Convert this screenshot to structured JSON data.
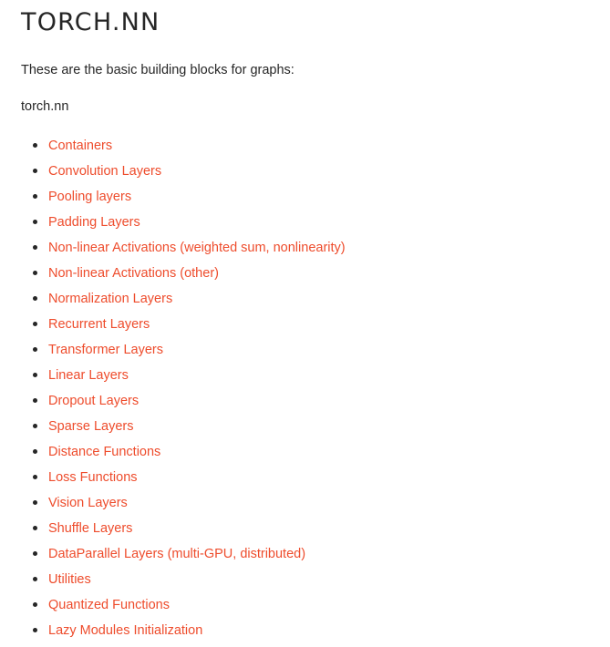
{
  "page": {
    "title": "TORCH.NN",
    "intro": "These are the basic building blocks for graphs:",
    "module_name": "torch.nn"
  },
  "colors": {
    "link": "#ee4c2c",
    "text": "#262626",
    "background": "#ffffff"
  },
  "toc": [
    {
      "label": "Containers"
    },
    {
      "label": "Convolution Layers"
    },
    {
      "label": "Pooling layers"
    },
    {
      "label": "Padding Layers"
    },
    {
      "label": "Non-linear Activations (weighted sum, nonlinearity)"
    },
    {
      "label": "Non-linear Activations (other)"
    },
    {
      "label": "Normalization Layers"
    },
    {
      "label": "Recurrent Layers"
    },
    {
      "label": "Transformer Layers"
    },
    {
      "label": "Linear Layers"
    },
    {
      "label": "Dropout Layers"
    },
    {
      "label": "Sparse Layers"
    },
    {
      "label": "Distance Functions"
    },
    {
      "label": "Loss Functions"
    },
    {
      "label": "Vision Layers"
    },
    {
      "label": "Shuffle Layers"
    },
    {
      "label": "DataParallel Layers (multi-GPU, distributed)"
    },
    {
      "label": "Utilities"
    },
    {
      "label": "Quantized Functions"
    },
    {
      "label": "Lazy Modules Initialization"
    }
  ]
}
